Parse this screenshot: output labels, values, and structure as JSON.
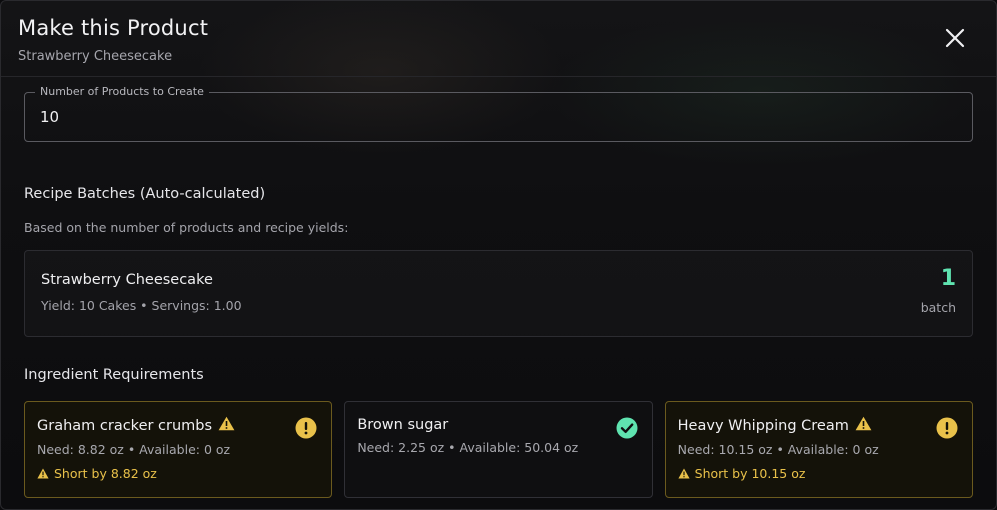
{
  "dialog": {
    "title": "Make this Product",
    "subtitle": "Strawberry Cheesecake",
    "close_icon": "close-icon"
  },
  "quantity_field": {
    "label": "Number of Products to Create",
    "value": "10"
  },
  "batches": {
    "title": "Recipe Batches (Auto-calculated)",
    "description": "Based on the number of products and recipe yields:",
    "items": [
      {
        "name": "Strawberry Cheesecake",
        "meta": "Yield: 10 Cakes • Servings: 1.00",
        "count": "1",
        "unit": "batch"
      }
    ]
  },
  "ingredients": {
    "title": "Ingredient Requirements",
    "items": [
      {
        "name": "Graham cracker crumbs",
        "need": "Need: 8.82 oz • Available: 0 oz",
        "short": "Short by 8.82 oz",
        "status": "warning"
      },
      {
        "name": "Brown sugar",
        "need": "Need: 2.25 oz • Available: 50.04 oz",
        "short": "",
        "status": "ok"
      },
      {
        "name": "Heavy Whipping Cream",
        "need": "Need: 10.15 oz • Available: 0 oz",
        "short": "Short by 10.15 oz",
        "status": "warning"
      }
    ]
  },
  "colors": {
    "accent_green": "#5fe3b0",
    "warning_yellow": "#e9c14a",
    "warning_border": "#6b5a1e"
  }
}
